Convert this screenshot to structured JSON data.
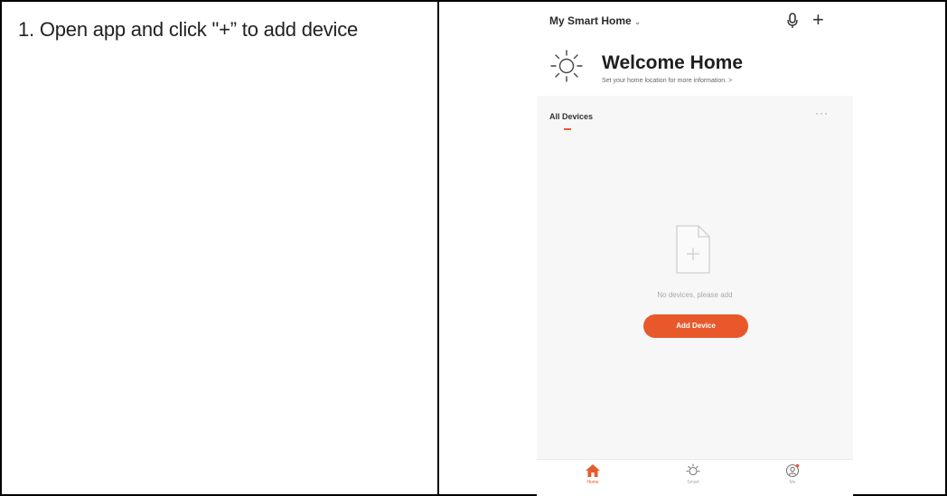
{
  "instruction": {
    "text": "1. Open app and click \"+” to add device"
  },
  "app": {
    "home_name": "My Smart Home",
    "header_chevron": "⌄",
    "add_symbol": "+",
    "welcome_title": "Welcome Home",
    "welcome_subtitle": "Set your home location for more information. >",
    "all_devices_label": "All Devices",
    "more_label": "···",
    "empty_message": "No devices, please add",
    "add_device_label": "Add Device",
    "accent_color": "#e9582b",
    "tabs": [
      {
        "label": "Home",
        "icon": "home-icon",
        "active": true
      },
      {
        "label": "Smart",
        "icon": "smart-sun-icon",
        "active": false
      },
      {
        "label": "Me",
        "icon": "profile-icon",
        "active": false
      }
    ]
  }
}
